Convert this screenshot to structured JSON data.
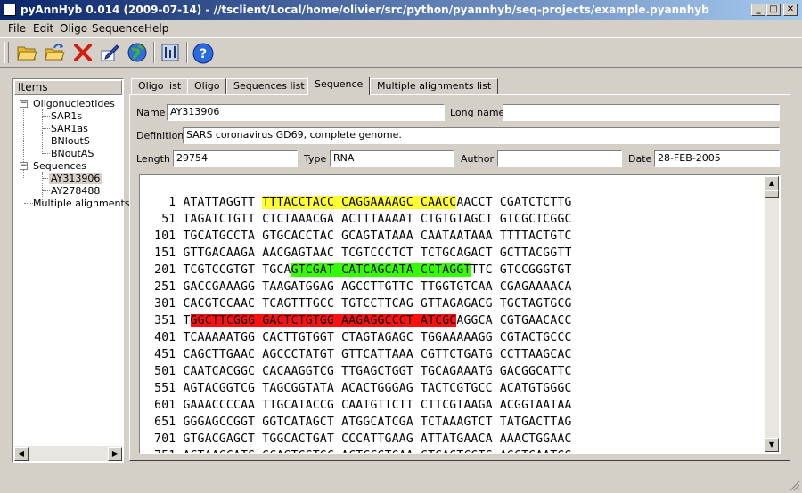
{
  "window": {
    "title": "pyAnnHyb 0.014 (2009-07-14) - //tsclient/Local/home/olivier/src/python/pyannhyb/seq-projects/example.pyannhyb"
  },
  "menu": [
    "File",
    "Edit",
    "Oligo",
    "Sequence",
    "Help"
  ],
  "toolbar": {
    "icons": [
      "open-folder-icon",
      "open-folder-arrow-icon",
      "delete-x-icon",
      "edit-pen-icon",
      "globe-icon",
      "tools-icon",
      "help-icon"
    ]
  },
  "tree": {
    "header": "Items",
    "oligo_group": "Oligonucleotides",
    "oligos": [
      "SAR1s",
      "SAR1as",
      "BNloutS",
      "BNoutAS"
    ],
    "seq_group": "Sequences",
    "sequences": [
      "AY313906",
      "AY278488"
    ],
    "alignments": "Multiple alignments"
  },
  "tabs": [
    "Oligo list",
    "Oligo",
    "Sequences list",
    "Sequence",
    "Multiple alignments list"
  ],
  "form": {
    "name_label": "Name",
    "name_value": "AY313906",
    "longname_label": "Long name",
    "longname_value": "",
    "definition_label": "Definition",
    "definition_value": "SARS coronavirus GD69, complete genome.",
    "length_label": "Length",
    "length_value": "29754",
    "type_label": "Type",
    "type_value": "RNA",
    "author_label": "Author",
    "author_value": "",
    "date_label": "Date",
    "date_value": "28-FEB-2005"
  },
  "highlight_colors": {
    "yellow": "#ffff33",
    "green": "#33ff00",
    "red": "#ff1010"
  },
  "sequence_lines": [
    {
      "num": "1",
      "segments": [
        {
          "t": "ATATTAGGTT "
        },
        {
          "t": "TTTACCTACC CAGGAAAAGC CAACC",
          "hl": "yellow"
        },
        {
          "t": "AACCT CGATCTCTTG"
        }
      ]
    },
    {
      "num": "51",
      "segments": [
        {
          "t": "TAGATCTGTT CTCTAAACGA ACTTTAAAAT CTGTGTAGCT GTCGCTCGGC"
        }
      ]
    },
    {
      "num": "101",
      "segments": [
        {
          "t": "TGCATGCCTA GTGCACCTAC GCAGTATAAA CAATAATAAA TTTTACTGTC"
        }
      ]
    },
    {
      "num": "151",
      "segments": [
        {
          "t": "GTTGACAAGA AACGAGTAAC TCGTCCCTCT TCTGCAGACT GCTTACGGTT"
        }
      ]
    },
    {
      "num": "201",
      "segments": [
        {
          "t": "TCGTCCGTGT TGCA"
        },
        {
          "t": "GTCGAT CATCAGCATA CCTAGGT",
          "hl": "green"
        },
        {
          "t": "TTC GTCCGGGTGT"
        }
      ]
    },
    {
      "num": "251",
      "segments": [
        {
          "t": "GACCGAAAGG TAAGATGGAG AGCCTTGTTC TTGGTGTCAA CGAGAAAACA"
        }
      ]
    },
    {
      "num": "301",
      "segments": [
        {
          "t": "CACGTCCAAC TCAGTTTGCC TGTCCTTCAG GTTAGAGACG TGCTAGTGCG"
        }
      ]
    },
    {
      "num": "351",
      "segments": [
        {
          "t": "T"
        },
        {
          "t": "GGCTTCGGG GACTCTGTGG AAGAGGCCCT ATCGC",
          "hl": "red"
        },
        {
          "t": "AGGCA CGTGAACACC"
        }
      ]
    },
    {
      "num": "401",
      "segments": [
        {
          "t": "TCAAAAATGG CACTTGTGGT CTAGTAGAGC TGGAAAAAGG CGTACTGCCC"
        }
      ]
    },
    {
      "num": "451",
      "segments": [
        {
          "t": "CAGCTTGAAC AGCCCTATGT GTTCATTAAA CGTTCTGATG CCTTAAGCAC"
        }
      ]
    },
    {
      "num": "501",
      "segments": [
        {
          "t": "CAATCACGGC CACAAGGTCG TTGAGCTGGT TGCAGAAATG GACGGCATTC"
        }
      ]
    },
    {
      "num": "551",
      "segments": [
        {
          "t": "AGTACGGTCG TAGCGGTATA ACACTGGGAG TACTCGTGCC ACATGTGGGC"
        }
      ]
    },
    {
      "num": "601",
      "segments": [
        {
          "t": "GAAACCCCAA TTGCATACCG CAATGTTCTT CTTCGTAAGA ACGGTAATAA"
        }
      ]
    },
    {
      "num": "651",
      "segments": [
        {
          "t": "GGGAGCCGGT GGTCATAGCT ATGGCATCGA TCTAAAGTCT TATGACTTAG"
        }
      ]
    },
    {
      "num": "701",
      "segments": [
        {
          "t": "GTGACGAGCT TGGCACTGAT CCCATTGAAG ATTATGAACA AAACTGGAAC"
        }
      ]
    },
    {
      "num": "751",
      "segments": [
        {
          "t": "ACTAAGCATG GCAGTGGTGC ACTCCGTGAA CTCACTCGTG AGCTCAATGG"
        }
      ]
    }
  ]
}
